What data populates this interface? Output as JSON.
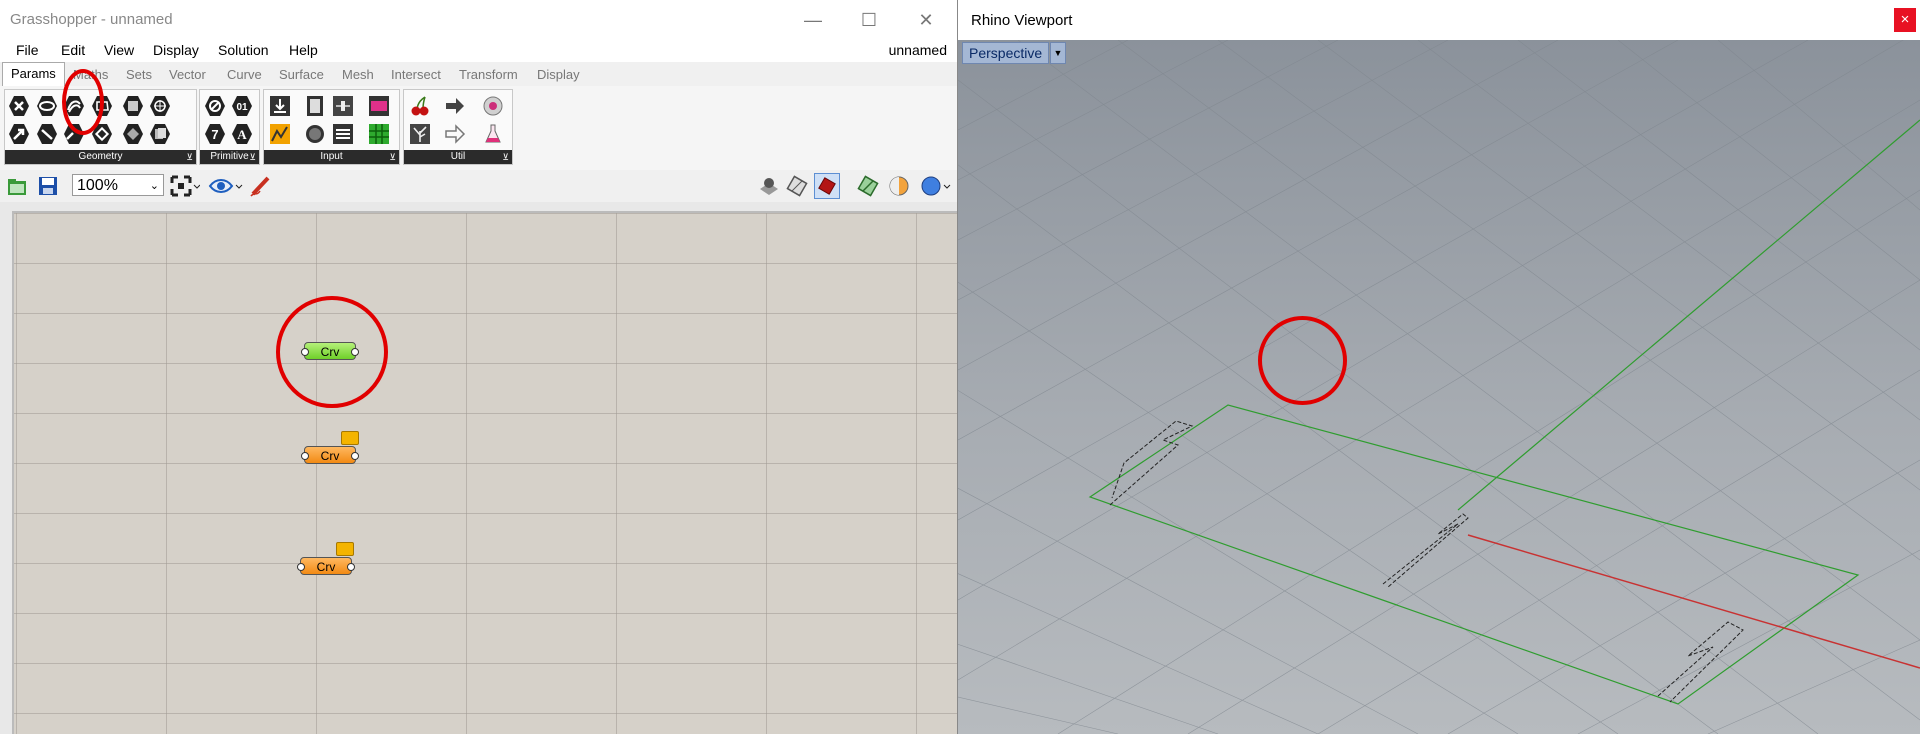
{
  "grasshopper": {
    "title": "Grasshopper - unnamed",
    "document_name": "unnamed",
    "menu": [
      "File",
      "Edit",
      "View",
      "Display",
      "Solution",
      "Help"
    ],
    "tabs": [
      "Params",
      "Maths",
      "Sets",
      "Vector",
      "Curve",
      "Surface",
      "Mesh",
      "Intersect",
      "Transform",
      "Display"
    ],
    "active_tab": "Params",
    "ribbon_groups": [
      "Geometry",
      "Primitive",
      "Input",
      "Util"
    ],
    "zoom": "100%",
    "components": [
      {
        "label": "Crv",
        "state": "ok",
        "color": "#7ed63a"
      },
      {
        "label": "Crv",
        "state": "warning",
        "color": "#f5941d"
      },
      {
        "label": "Crv",
        "state": "warning",
        "color": "#f5941d"
      }
    ]
  },
  "rhino": {
    "title": "Rhino Viewport",
    "viewport_label": "Perspective",
    "close_symbol": "×"
  },
  "colors": {
    "highlight_ring": "#e10000",
    "grid_green": "#2f9d2f",
    "axis_red": "#c83232"
  }
}
